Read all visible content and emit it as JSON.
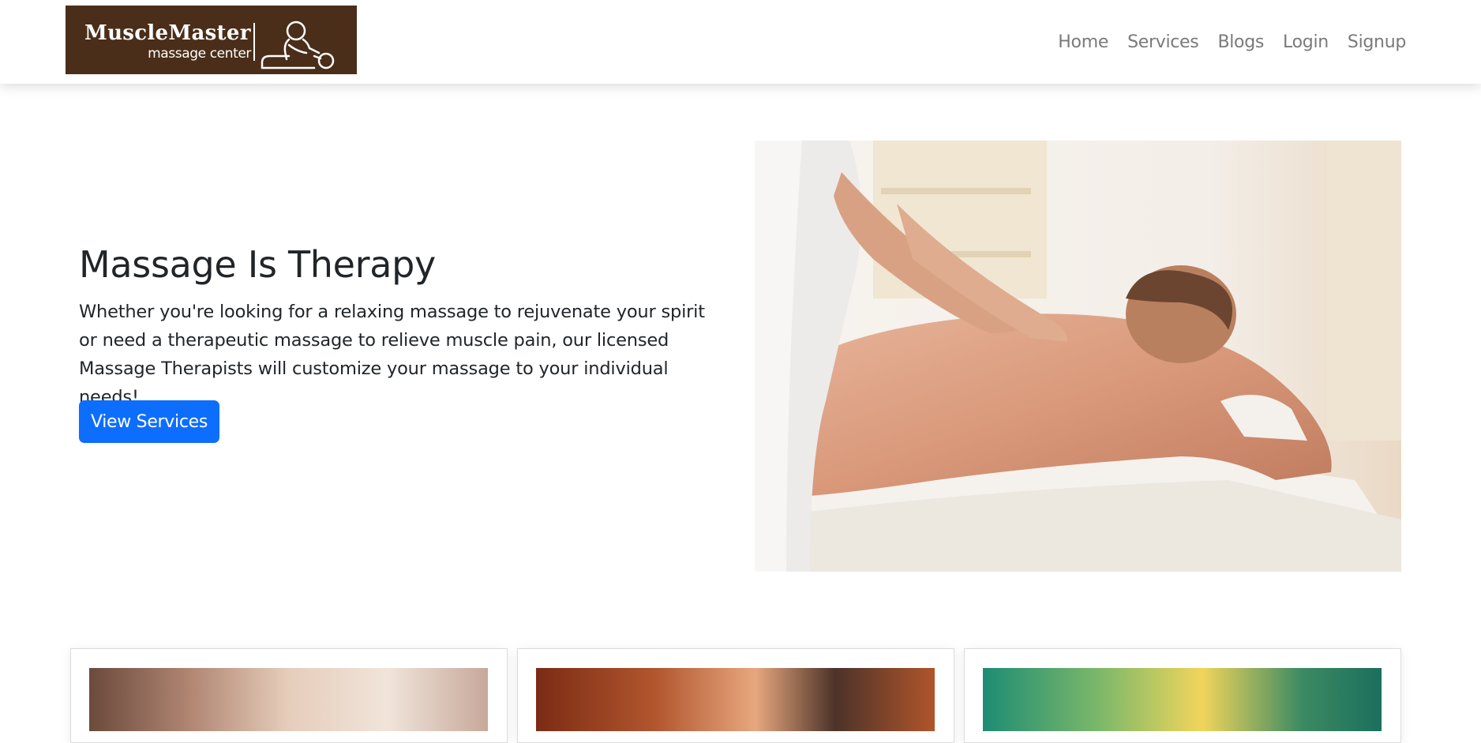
{
  "brand": {
    "name": "MuscleMaster",
    "tagline": "massage center",
    "color": "#4a2e19"
  },
  "nav": {
    "items": [
      {
        "label": "Home"
      },
      {
        "label": "Services"
      },
      {
        "label": "Blogs"
      },
      {
        "label": "Login"
      },
      {
        "label": "Signup"
      }
    ]
  },
  "hero": {
    "title": "Massage Is Therapy",
    "text": "Whether you're looking for a relaxing massage to rejuvenate your spirit or need a therapeutic massage to relieve muscle pain, our licensed Massage Therapists will customize your massage to your individual needs!",
    "cta_label": "View Services",
    "cta_color": "#0d6efd",
    "image": "massage-photo"
  },
  "cards": [
    {
      "image": "massage-back-photo"
    },
    {
      "image": "hot-stone-massage-photo"
    },
    {
      "image": "spa-nature-photo"
    }
  ]
}
